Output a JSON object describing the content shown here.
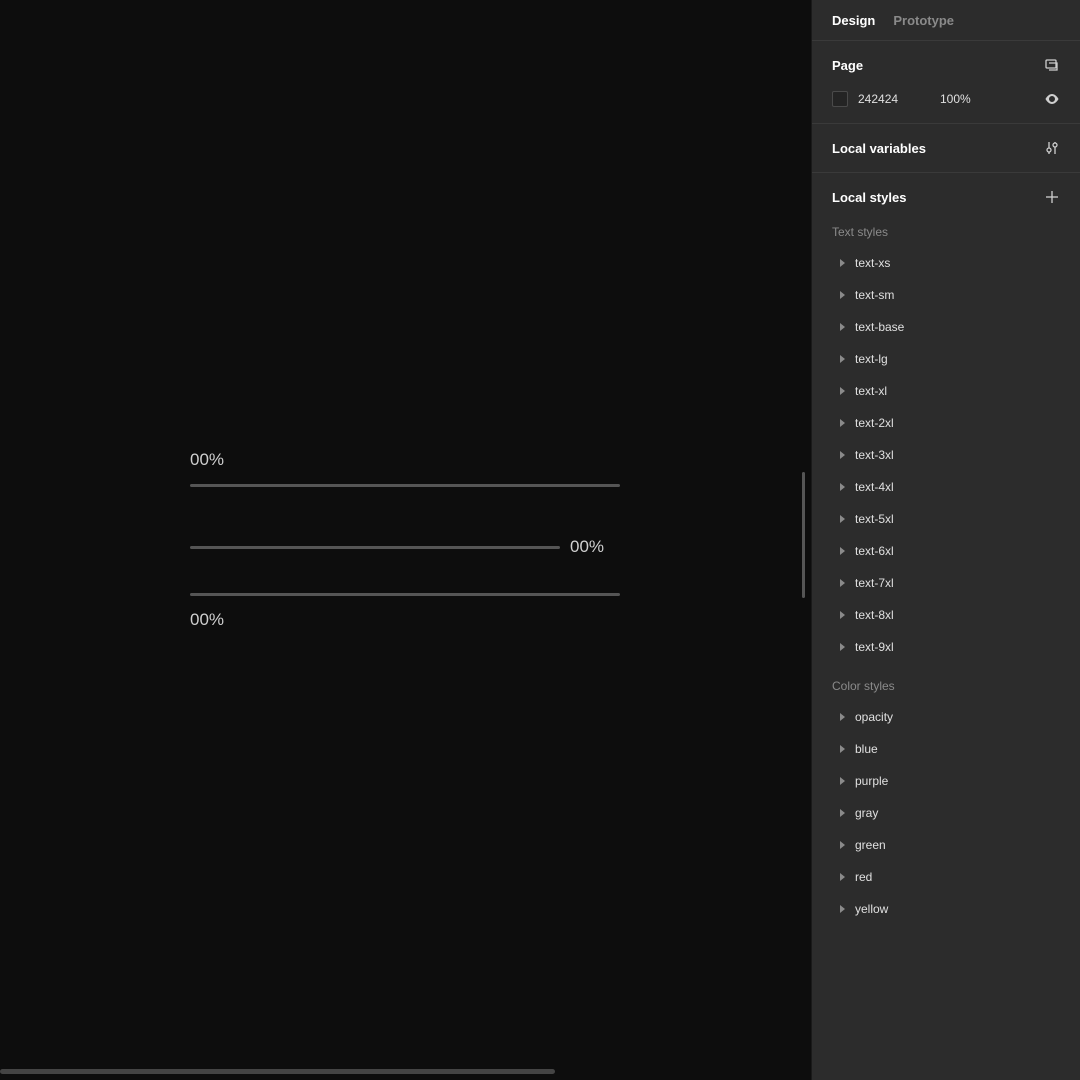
{
  "tabs": {
    "design": "Design",
    "prototype": "Prototype"
  },
  "page": {
    "title": "Page",
    "hex": "242424",
    "opacity": "100%"
  },
  "local_variables": {
    "title": "Local variables"
  },
  "local_styles": {
    "title": "Local styles"
  },
  "text_styles": {
    "header": "Text styles",
    "items": [
      "text-xs",
      "text-sm",
      "text-base",
      "text-lg",
      "text-xl",
      "text-2xl",
      "text-3xl",
      "text-4xl",
      "text-5xl",
      "text-6xl",
      "text-7xl",
      "text-8xl",
      "text-9xl"
    ]
  },
  "color_styles": {
    "header": "Color styles",
    "items": [
      "opacity",
      "blue",
      "purple",
      "gray",
      "green",
      "red",
      "yellow"
    ]
  },
  "canvas": {
    "prog1": "00%",
    "prog2": "00%",
    "prog3": "00%"
  }
}
